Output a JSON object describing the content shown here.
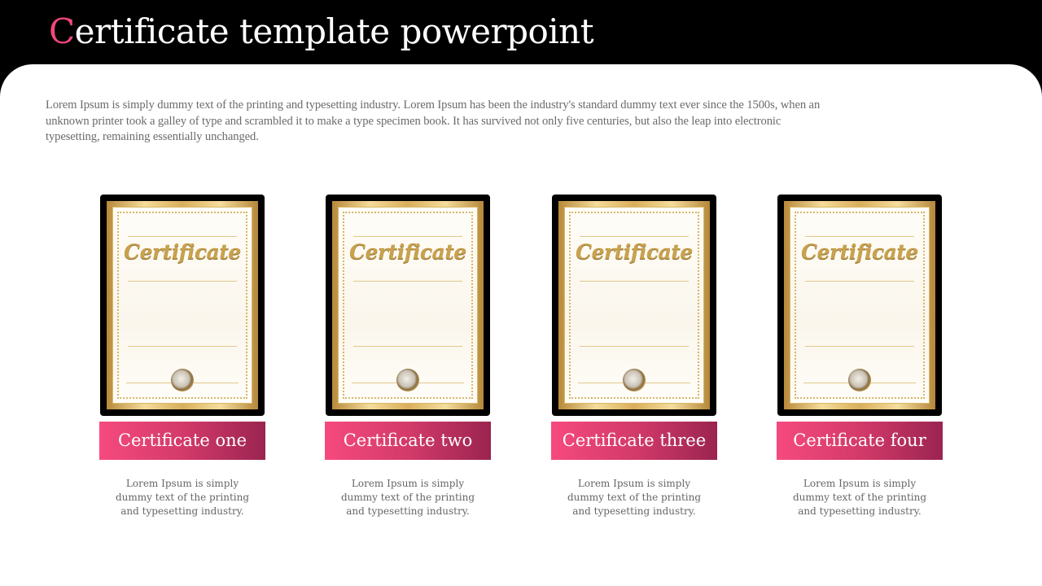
{
  "slide": {
    "title_first_letter": "C",
    "title_rest": "ertificate template powerpoint",
    "intro": "Lorem Ipsum is simply dummy text of the printing and typesetting industry. Lorem Ipsum has been the industry's standard dummy text ever since the 1500s, when an unknown printer took a galley of type and scrambled it to make a type specimen book. It has survived not only five centuries, but also the leap into electronic typesetting, remaining essentially unchanged."
  },
  "colors": {
    "accent": "#f0487a",
    "label_gradient_start": "#f64a7e",
    "label_gradient_end": "#9b2450",
    "background": "#000000"
  },
  "cards": [
    {
      "image_text": "Certificate",
      "label": "Certificate one",
      "description": "Lorem Ipsum is simply dummy text of the printing and typesetting industry."
    },
    {
      "image_text": "Certificate",
      "label": "Certificate two",
      "description": "Lorem Ipsum is simply dummy text of the printing and typesetting industry."
    },
    {
      "image_text": "Certificate",
      "label": "Certificate three",
      "description": "Lorem Ipsum is simply dummy text of the printing and typesetting industry."
    },
    {
      "image_text": "Certificate",
      "label": "Certificate four",
      "description": "Lorem Ipsum is simply dummy text of the printing and typesetting industry."
    }
  ]
}
